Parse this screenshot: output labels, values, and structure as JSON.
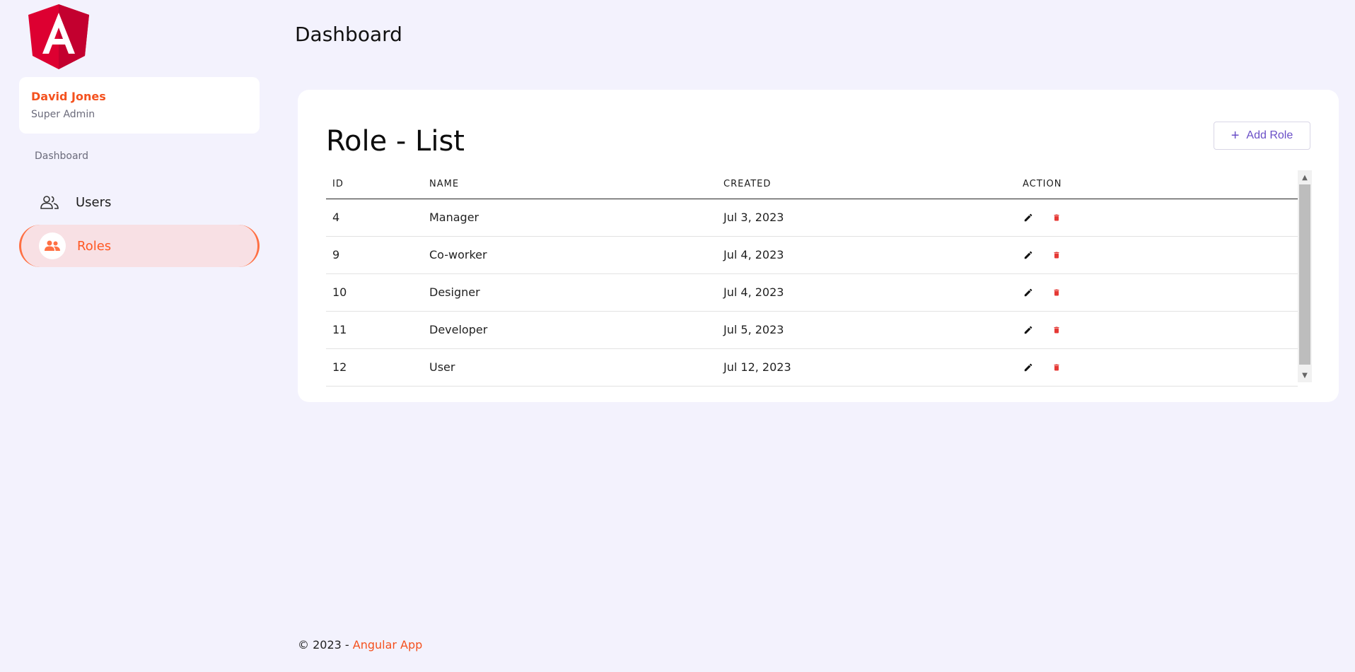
{
  "header": {
    "title": "Dashboard"
  },
  "user": {
    "name": "David Jones",
    "role": "Super Admin"
  },
  "sidebar": {
    "section_label": "Dashboard",
    "items": [
      {
        "label": "Users",
        "icon": "users-icon",
        "active": false
      },
      {
        "label": "Roles",
        "icon": "roles-icon",
        "active": true
      }
    ]
  },
  "main": {
    "title": "Role - List",
    "add_button_label": "Add Role",
    "table": {
      "columns": [
        "ID",
        "NAME",
        "CREATED",
        "ACTION"
      ],
      "rows": [
        {
          "id": "4",
          "name": "Manager",
          "created": "Jul 3, 2023"
        },
        {
          "id": "9",
          "name": "Co-worker",
          "created": "Jul 4, 2023"
        },
        {
          "id": "10",
          "name": "Designer",
          "created": "Jul 4, 2023"
        },
        {
          "id": "11",
          "name": "Developer",
          "created": "Jul 5, 2023"
        },
        {
          "id": "12",
          "name": "User",
          "created": "Jul 12, 2023"
        }
      ]
    }
  },
  "footer": {
    "copyright": "© 2023 - ",
    "brand": "Angular App"
  },
  "colors": {
    "accent": "#f4511e",
    "active_bg": "#f8e0e4",
    "primary_button": "#6a4fc7",
    "delete": "#e53935",
    "page_bg": "#f3f2fd"
  }
}
